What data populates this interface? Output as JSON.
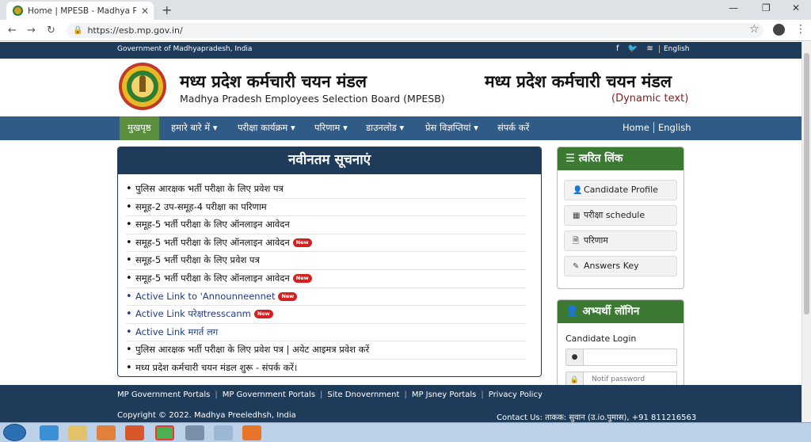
{
  "browser": {
    "tab_title": "Home | MPESB - Madhya Prades",
    "tab_close": "✕",
    "new_tab": "+",
    "url": "https://esb.mp.gov.in/",
    "back": "←",
    "forward": "→",
    "reload": "↻",
    "star": "☆",
    "menu": "⋮",
    "window_min": "—",
    "window_max": "❐",
    "window_close": "✕"
  },
  "topstrip": {
    "gov_text": "Government of Madhyapradesh, India",
    "social_icons": [
      "facebook-icon",
      "twitter-icon",
      "rss-icon"
    ],
    "social_glyphs": "f 🐦 ≋",
    "language": "English"
  },
  "header": {
    "title_hindi": "मध्य प्रदेश कर्मचारी चयन मंडल",
    "title_english": "Madhya Pradesh Employees Selection Board (MPESB)",
    "title_hindi_right": "मध्य प्रदेश कर्मचारी चयन मंडल",
    "dynamic_text": "(Dynamic text)"
  },
  "nav": {
    "items": [
      {
        "label": "मुखपृष्ठ",
        "active": true
      },
      {
        "label": "हमारे बारे में ▾",
        "active": false
      },
      {
        "label": "परीक्षा कार्यक्रम ▾",
        "active": false
      },
      {
        "label": "परिणाम ▾",
        "active": false
      },
      {
        "label": "डाउनलोड ▾",
        "active": false
      },
      {
        "label": "प्रेस विज्ञप्तियां ▾",
        "active": false
      },
      {
        "label": "संपर्क करें",
        "active": false
      }
    ],
    "right_home": "Home",
    "right_lang": "English"
  },
  "notices": {
    "heading": "नवीनतम सूचनाएं",
    "new_badge": "New",
    "items": [
      {
        "text": "पुलिस आरक्षक भर्ती परीक्षा के लिए प्रवेश पत्र",
        "is_new": false
      },
      {
        "text": "समूह-2 उप-समूह-4 परीक्षा का परिणाम",
        "is_new": false
      },
      {
        "text": "समूह-5 भर्ती परीक्षा के लिए ऑनलाइन आवेदन",
        "is_new": false
      },
      {
        "text": "समूह-5 भर्ती परीक्षा के लिए ऑनलाइन आवेदन",
        "is_new": true
      },
      {
        "text": "समूह-5 भर्ती परीक्षा के लिए प्रवेश पत्र",
        "is_new": false
      },
      {
        "text": "समूह-5 भर्ती परीक्षा के लिए ऑनलाइन आवेदन",
        "is_new": true
      },
      {
        "text": "Active Link to 'Announneennet",
        "is_new": true
      },
      {
        "text": "Active Link परेक्षtresscanm",
        "is_new": true
      },
      {
        "text": "Active Link मगर्त लग",
        "is_new": false
      },
      {
        "text": "पुलिस आरक्षक भर्ती परीक्षा के लिए प्रवेश पत्र | अयेट आइमत्र प्रवेश करें",
        "is_new": false
      },
      {
        "text": "मध्य प्रदेश कर्मचारी चयन मंडल शुरू - संपर्क करें।",
        "is_new": false
      }
    ]
  },
  "quick_links": {
    "heading": "त्वरित लिंक",
    "items": [
      {
        "label": "Candidate Profile",
        "icon": "user-icon",
        "glyph": "👤"
      },
      {
        "label": "परीक्षा schedule",
        "icon": "calendar-icon",
        "glyph": "▦"
      },
      {
        "label": "परिणाम",
        "icon": "document-icon",
        "glyph": "🗎"
      },
      {
        "label": "Answers Key",
        "icon": "edit-icon",
        "glyph": "✎"
      }
    ]
  },
  "login": {
    "heading": "अभ्यर्थी लॉगिन",
    "label": "Candidate Login",
    "password_placeholder": "Notif password"
  },
  "footer": {
    "links": [
      "MP Government Portals",
      "MP Government Portals",
      "Site Dnovernment",
      "MP Jsney Portals",
      "Privacy Policy"
    ],
    "copyright": "Copyright © 2022. Madhya Preeledhsh, India",
    "contact": "Contact Us: ताकक: सुवान (उ.io.पुमास), +91 811216563"
  },
  "colors": {
    "nav_blue": "#2f5b86",
    "dark_blue": "#1f3b5a",
    "green": "#3c7a34",
    "new_red": "#d42020",
    "dynamic_red": "#8b1a1a"
  }
}
